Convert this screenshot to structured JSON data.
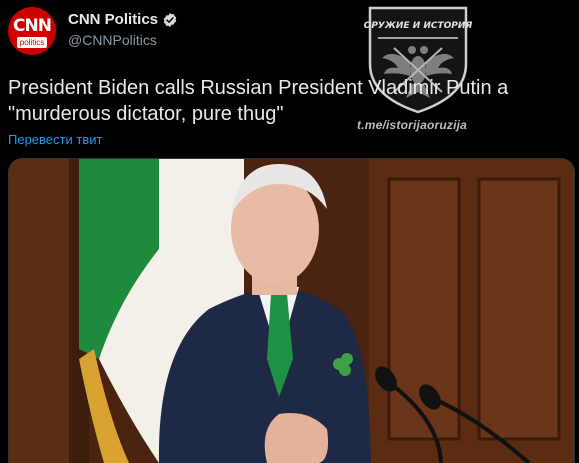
{
  "tweet": {
    "author": {
      "display_name": "CNN Politics",
      "handle": "@CNNPolitics",
      "avatar_logo": "CNN",
      "avatar_tag": "politics",
      "verified": true
    },
    "text": "President Biden calls Russian President Vladimir Putin a \"murderous dictator, pure thug\"",
    "translate_label": "Перевести твит"
  },
  "watermark": {
    "title": "ОРУЖИЕ И ИСТОРИЯ",
    "url": "t.me/istorijaoruzija"
  },
  "colors": {
    "background": "#000000",
    "text": "#e7e9ea",
    "secondary_text": "#8b98a5",
    "link": "#1d9bf0",
    "verified_badge": "#d9d9d9",
    "brand_red": "#cc0000"
  },
  "icons": [
    "verified-badge-icon"
  ]
}
